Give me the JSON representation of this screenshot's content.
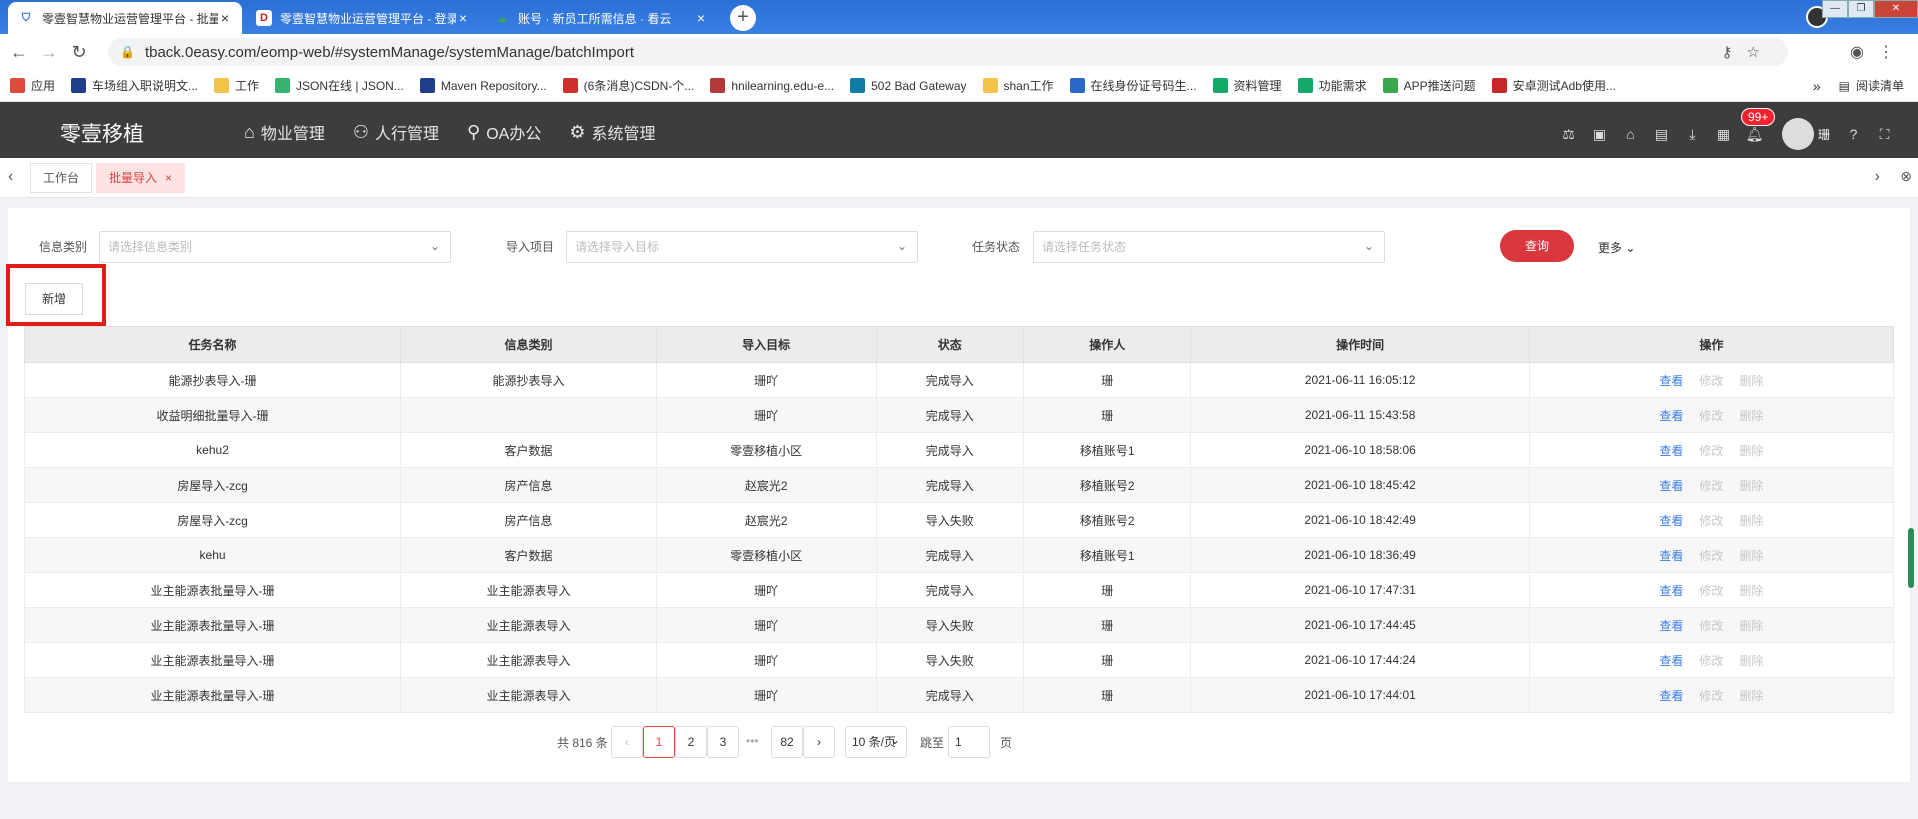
{
  "browser": {
    "tabs": [
      {
        "title": "零壹智慧物业运营管理平台 - 批量",
        "active": true
      },
      {
        "title": "零壹智慧物业运营管理平台 - 登录",
        "active": false
      },
      {
        "title": "账号 · 新员工所需信息 · 看云",
        "active": false
      }
    ],
    "url": "tback.0easy.com/eomp-web/#systemManage/systemManage/batchImport",
    "bookmarks": [
      {
        "label": "应用",
        "color": "#e04a3a"
      },
      {
        "label": "车场组入职说明文...",
        "color": "#1f3f8a"
      },
      {
        "label": "工作",
        "color": "#f3c34a"
      },
      {
        "label": "JSON在线 | JSON...",
        "color": "#38b36f"
      },
      {
        "label": "Maven Repository...",
        "color": "#1f3f8a"
      },
      {
        "label": "(6条消息)CSDN-个...",
        "color": "#d12e2e"
      },
      {
        "label": "hnilearning.edu-e...",
        "color": "#b23a3a"
      },
      {
        "label": "502 Bad Gateway",
        "color": "#0f7ea6"
      },
      {
        "label": "shan工作",
        "color": "#f3c34a"
      },
      {
        "label": "在线身份证号码生...",
        "color": "#2a68c8"
      },
      {
        "label": "资料管理",
        "color": "#14a869"
      },
      {
        "label": "功能需求",
        "color": "#14a869"
      },
      {
        "label": "APP推送问题",
        "color": "#3aa84a"
      },
      {
        "label": "安卓测试Adb使用...",
        "color": "#c62828"
      }
    ],
    "reading_list": "阅读清单"
  },
  "app": {
    "logo": "零壹移植",
    "nav": [
      {
        "label": "物业管理",
        "icon": "home-icon"
      },
      {
        "label": "人行管理",
        "icon": "users-icon"
      },
      {
        "label": "OA办公",
        "icon": "person-icon"
      },
      {
        "label": "系统管理",
        "icon": "gear-icon"
      }
    ],
    "notification_badge": "99+",
    "user_name": "珊"
  },
  "page_tabs": {
    "workbench": "工作台",
    "current": "批量导入"
  },
  "filters": {
    "info_type_label": "信息类别",
    "info_type_placeholder": "请选择信息类别",
    "import_item_label": "导入项目",
    "import_item_placeholder": "请选择导入目标",
    "task_status_label": "任务状态",
    "task_status_placeholder": "请选择任务状态",
    "query_button": "查询",
    "more_label": "更多"
  },
  "add_button": "新增",
  "table": {
    "headers": [
      "任务名称",
      "信息类别",
      "导入目标",
      "状态",
      "操作人",
      "操作时间",
      "操作"
    ],
    "rows": [
      [
        "能源抄表导入-珊",
        "能源抄表导入",
        "珊吖",
        "完成导入",
        "珊",
        "2021-06-11 16:05:12"
      ],
      [
        "收益明细批量导入-珊",
        "",
        "珊吖",
        "完成导入",
        "珊",
        "2021-06-11 15:43:58"
      ],
      [
        "kehu2",
        "客户数据",
        "零壹移植小区",
        "完成导入",
        "移植账号1",
        "2021-06-10 18:58:06"
      ],
      [
        "房屋导入-zcg",
        "房产信息",
        "赵宸光2",
        "完成导入",
        "移植账号2",
        "2021-06-10 18:45:42"
      ],
      [
        "房屋导入-zcg",
        "房产信息",
        "赵宸光2",
        "导入失败",
        "移植账号2",
        "2021-06-10 18:42:49"
      ],
      [
        "kehu",
        "客户数据",
        "零壹移植小区",
        "完成导入",
        "移植账号1",
        "2021-06-10 18:36:49"
      ],
      [
        "业主能源表批量导入-珊",
        "业主能源表导入",
        "珊吖",
        "完成导入",
        "珊",
        "2021-06-10 17:47:31"
      ],
      [
        "业主能源表批量导入-珊",
        "业主能源表导入",
        "珊吖",
        "导入失败",
        "珊",
        "2021-06-10 17:44:45"
      ],
      [
        "业主能源表批量导入-珊",
        "业主能源表导入",
        "珊吖",
        "导入失败",
        "珊",
        "2021-06-10 17:44:24"
      ],
      [
        "业主能源表批量导入-珊",
        "业主能源表导入",
        "珊吖",
        "完成导入",
        "珊",
        "2021-06-10 17:44:01"
      ]
    ],
    "actions": {
      "view": "查看",
      "edit": "修改",
      "delete": "删除"
    }
  },
  "pagination": {
    "total_text": "共 816 条",
    "pages": [
      "1",
      "2",
      "3"
    ],
    "ellipsis": "•••",
    "last_page": "82",
    "page_size": "10 条/页",
    "jump_label": "跳至",
    "jump_value": "1",
    "page_suffix": "页"
  }
}
